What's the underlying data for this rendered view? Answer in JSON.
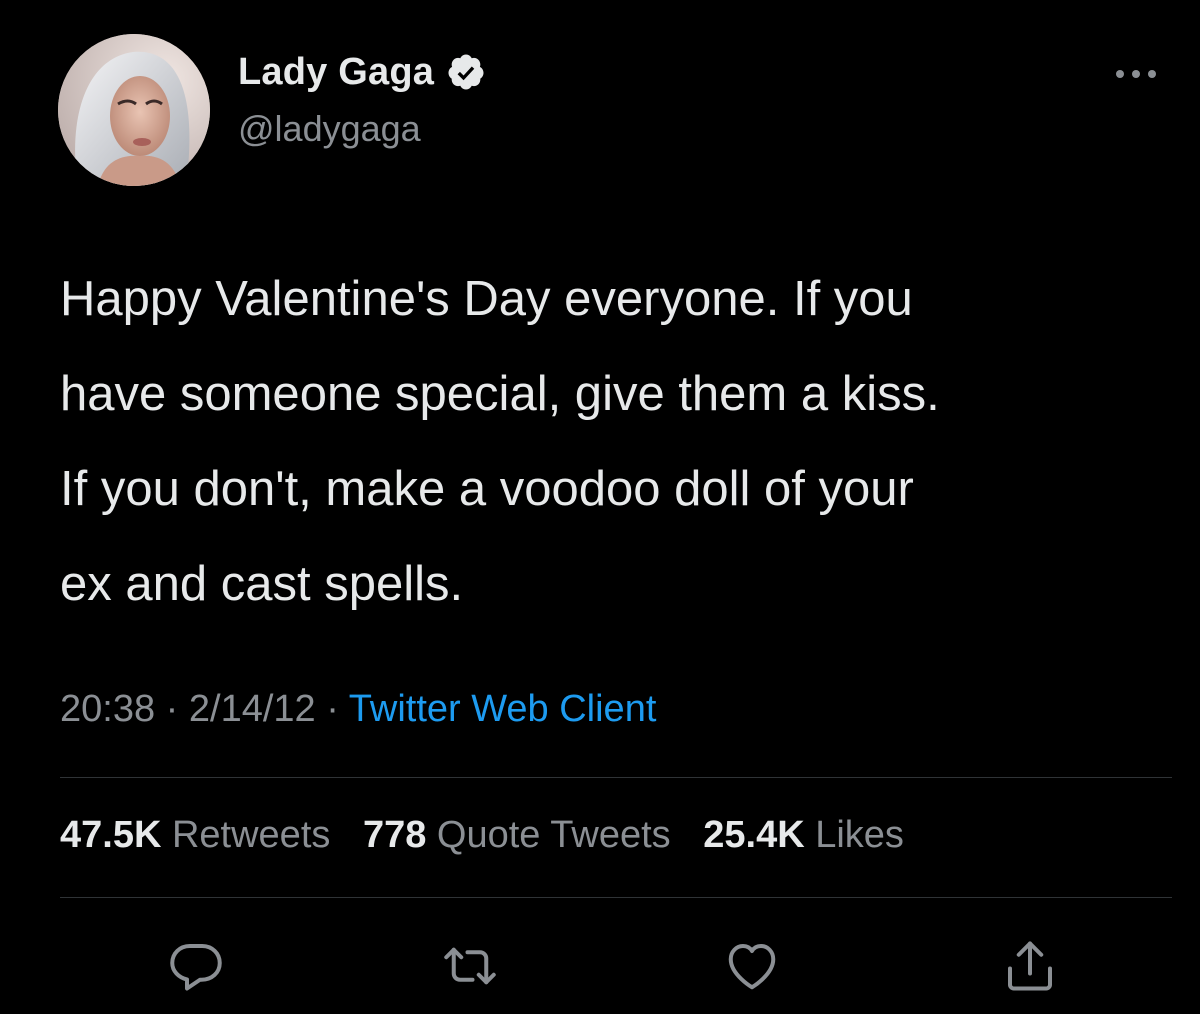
{
  "author": {
    "display_name": "Lady Gaga",
    "handle": "@ladygaga",
    "verified_icon": "verified-badge-icon",
    "avatar": "profile-photo"
  },
  "tweet": {
    "text": "Happy Valentine's Day everyone. If you\nhave someone special, give them a kiss.\nIf you don't, make a voodoo doll of your\nex and cast spells.",
    "time": "20:38",
    "date": "2/14/12",
    "separator": "·",
    "source": "Twitter Web Client"
  },
  "stats": {
    "retweets_count": "47.5K",
    "retweets_label": "Retweets",
    "quotes_count": "778",
    "quotes_label": "Quote Tweets",
    "likes_count": "25.4K",
    "likes_label": "Likes"
  },
  "actions": [
    {
      "name": "reply",
      "icon": "reply-icon"
    },
    {
      "name": "retweet",
      "icon": "retweet-icon"
    },
    {
      "name": "like",
      "icon": "heart-icon"
    },
    {
      "name": "share",
      "icon": "share-icon"
    }
  ],
  "colors": {
    "background": "#000000",
    "text": "#e7e9ea",
    "secondary_text": "#8b8f94",
    "link": "#1d9bf0",
    "divider": "#2f3336"
  }
}
